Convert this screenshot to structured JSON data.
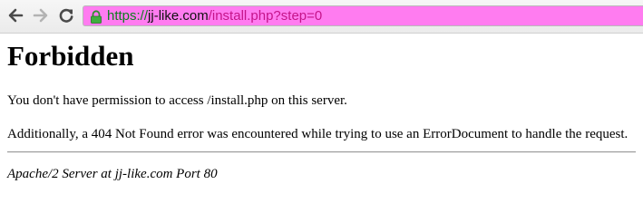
{
  "browser": {
    "icons": {
      "back": "back-arrow-icon",
      "forward": "forward-arrow-icon",
      "reload": "reload-icon",
      "lock": "lock-icon"
    },
    "address_bar": {
      "scheme": "https://",
      "host": "jj-like.com",
      "path": "/install.php?step=0",
      "background": "#ff7cf0"
    }
  },
  "page": {
    "title": "Forbidden",
    "message": "You don't have permission to access /install.php on this server.",
    "additional": "Additionally, a 404 Not Found error was encountered while trying to use an ErrorDocument to handle the request.",
    "server_signature": "Apache/2 Server at jj-like.com Port 80"
  }
}
